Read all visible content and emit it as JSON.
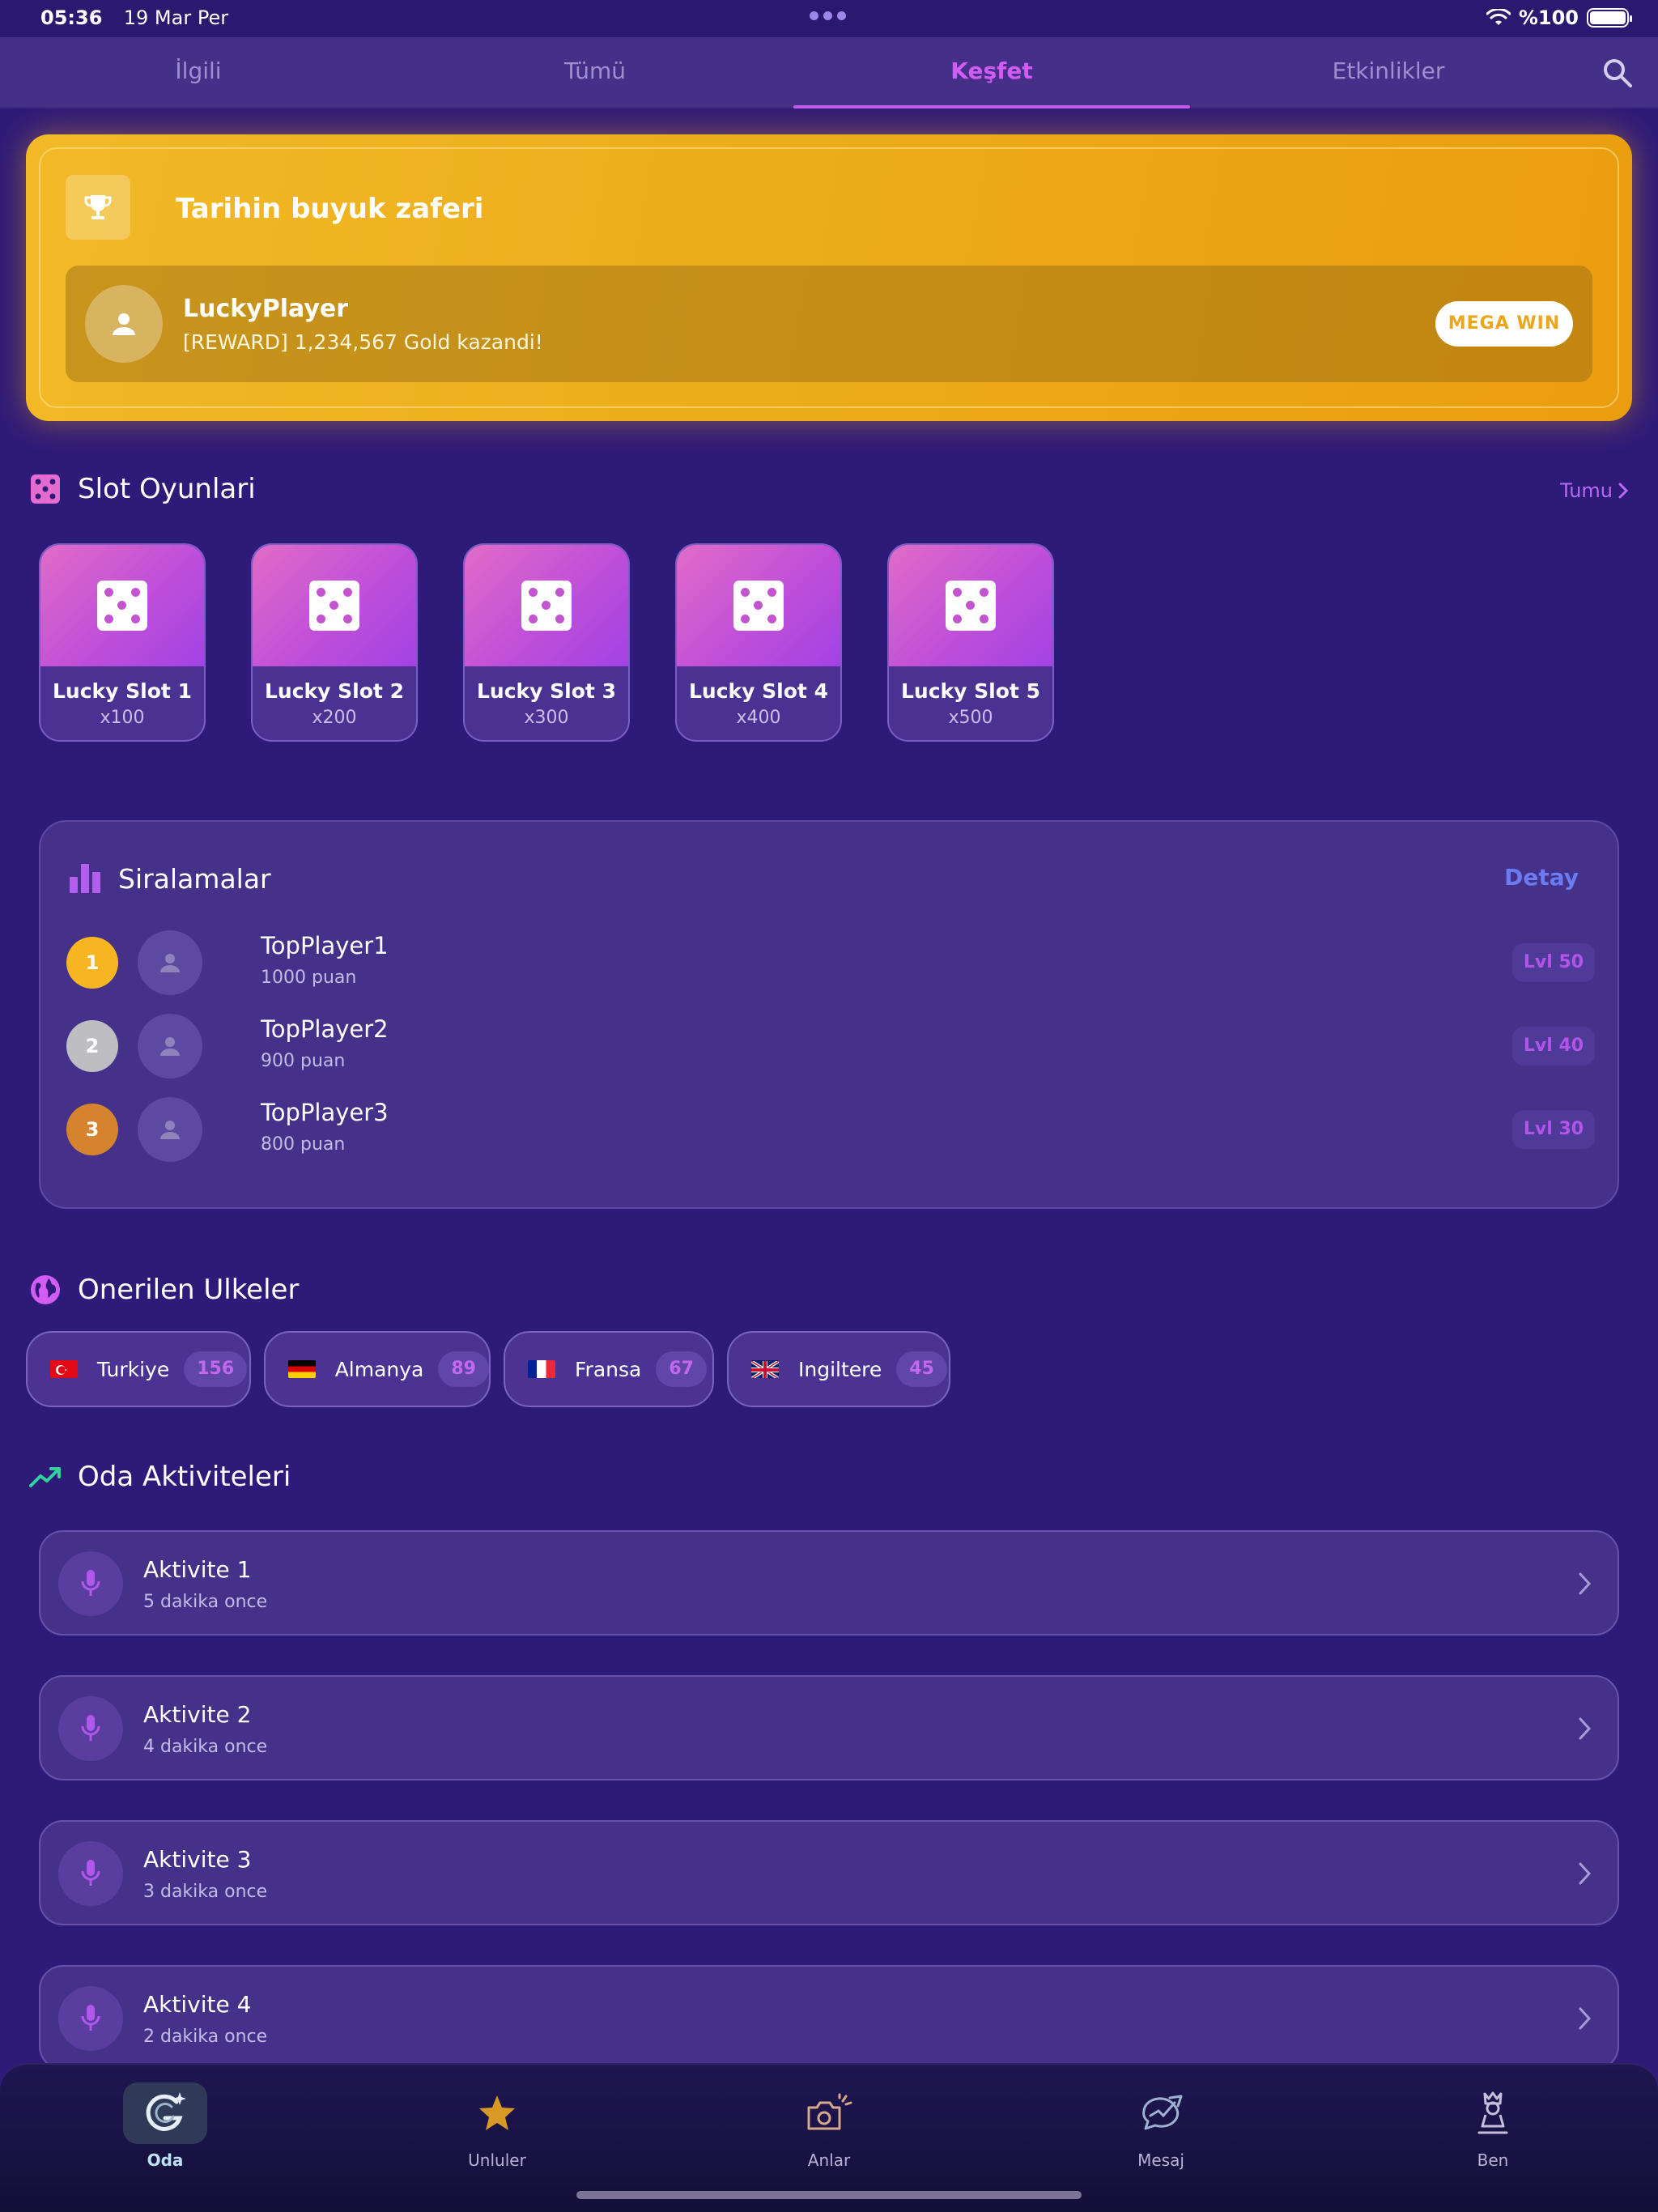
{
  "status_bar": {
    "time": "05:36",
    "date": "19 Mar Per",
    "battery": "%100"
  },
  "tabs": [
    {
      "label": "İlgili"
    },
    {
      "label": "Tümü"
    },
    {
      "label": "Keşfet"
    },
    {
      "label": "Etkinlikler"
    }
  ],
  "hero": {
    "title": "Tarihin buyuk zaferi",
    "player": "LuckyPlayer",
    "message": "[REWARD] 1,234,567 Gold kazandi!",
    "badge": "MEGA WIN"
  },
  "slots_section": {
    "title": "Slot Oyunlari",
    "see_all": "Tumu",
    "items": [
      {
        "name": "Lucky Slot 1",
        "multiplier": "x100"
      },
      {
        "name": "Lucky Slot 2",
        "multiplier": "x200"
      },
      {
        "name": "Lucky Slot 3",
        "multiplier": "x300"
      },
      {
        "name": "Lucky Slot 4",
        "multiplier": "x400"
      },
      {
        "name": "Lucky Slot 5",
        "multiplier": "x500"
      }
    ]
  },
  "rankings": {
    "title": "Siralamalar",
    "detail": "Detay",
    "items": [
      {
        "rank": "1",
        "name": "TopPlayer1",
        "points": "1000 puan",
        "level": "Lvl 50"
      },
      {
        "rank": "2",
        "name": "TopPlayer2",
        "points": "900 puan",
        "level": "Lvl 40"
      },
      {
        "rank": "3",
        "name": "TopPlayer3",
        "points": "800 puan",
        "level": "Lvl 30"
      }
    ]
  },
  "countries": {
    "title": "Onerilen Ulkeler",
    "items": [
      {
        "name": "Turkiye",
        "count": "156"
      },
      {
        "name": "Almanya",
        "count": "89"
      },
      {
        "name": "Fransa",
        "count": "67"
      },
      {
        "name": "Ingiltere",
        "count": "45"
      }
    ]
  },
  "activities": {
    "title": "Oda Aktiviteleri",
    "items": [
      {
        "title": "Aktivite 1",
        "time": "5 dakika once"
      },
      {
        "title": "Aktivite 2",
        "time": "4 dakika once"
      },
      {
        "title": "Aktivite 3",
        "time": "3 dakika once"
      },
      {
        "title": "Aktivite 4",
        "time": "2 dakika once"
      }
    ]
  },
  "bottom_nav": [
    {
      "label": "Oda"
    },
    {
      "label": "Unluler"
    },
    {
      "label": "Anlar"
    },
    {
      "label": "Mesaj"
    },
    {
      "label": "Ben"
    }
  ]
}
